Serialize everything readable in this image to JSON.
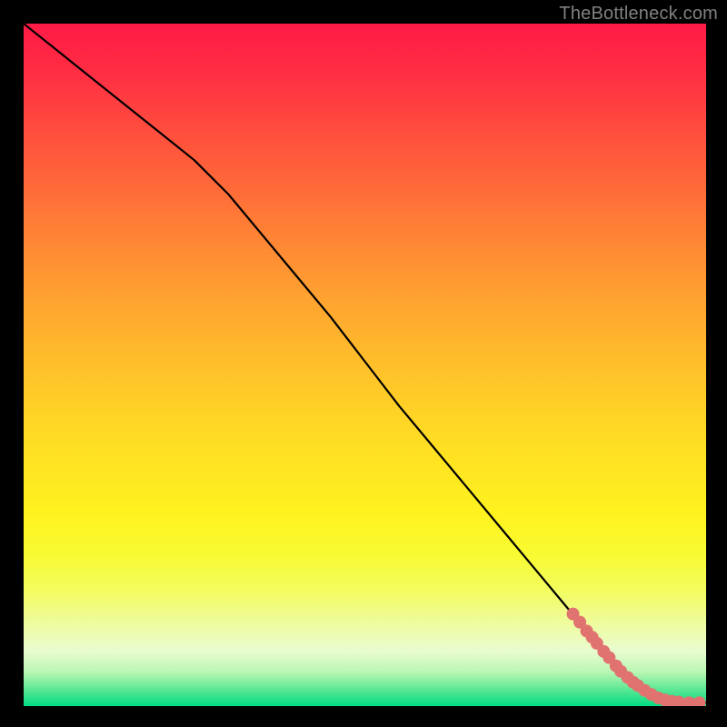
{
  "watermark": "TheBottleneck.com",
  "colors": {
    "curve": "#000000",
    "point": "#e0736f"
  },
  "chart_data": {
    "type": "line",
    "title": "",
    "xlabel": "",
    "ylabel": "",
    "xlim": [
      0,
      100
    ],
    "ylim": [
      0,
      100
    ],
    "grid": false,
    "series": [
      {
        "name": "bottleneck-curve",
        "x": [
          0,
          5,
          10,
          15,
          20,
          25,
          30,
          35,
          40,
          45,
          50,
          55,
          60,
          65,
          70,
          75,
          80,
          85,
          88,
          90,
          92,
          94,
          96,
          98,
          100
        ],
        "y": [
          100,
          96,
          92,
          88,
          84,
          80,
          75,
          69,
          63,
          57,
          50.5,
          44,
          38,
          32,
          26,
          20,
          14,
          8,
          5,
          3.4,
          2.2,
          1.3,
          0.8,
          0.5,
          0.5
        ]
      }
    ],
    "points": {
      "name": "highlight-cluster",
      "xy": [
        [
          80.5,
          13.5
        ],
        [
          81.5,
          12.3
        ],
        [
          82.5,
          11.0
        ],
        [
          83.3,
          10.1
        ],
        [
          84.0,
          9.2
        ],
        [
          85.0,
          8.0
        ],
        [
          85.8,
          7.1
        ],
        [
          86.8,
          5.9
        ],
        [
          87.5,
          5.1
        ],
        [
          88.5,
          4.2
        ],
        [
          89.3,
          3.5
        ],
        [
          90.0,
          3.0
        ],
        [
          91.0,
          2.3
        ],
        [
          92.0,
          1.7
        ],
        [
          93.0,
          1.2
        ],
        [
          94.0,
          0.9
        ],
        [
          95.0,
          0.7
        ],
        [
          96.0,
          0.6
        ],
        [
          97.5,
          0.5
        ],
        [
          99.0,
          0.5
        ]
      ]
    }
  }
}
